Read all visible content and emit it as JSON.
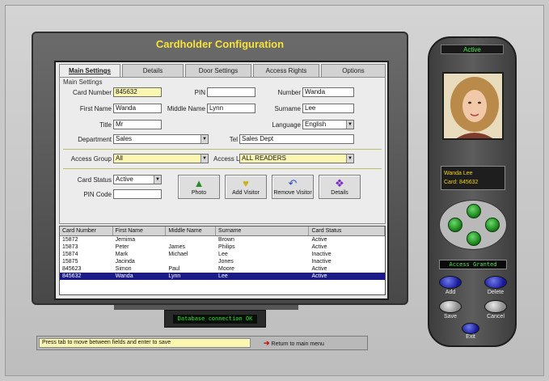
{
  "window": {
    "title": "Cardholder Configuration"
  },
  "tabs": [
    {
      "label": "Main Settings",
      "active": true
    },
    {
      "label": "Details"
    },
    {
      "label": "Door Settings"
    },
    {
      "label": "Access Rights"
    },
    {
      "label": "Options"
    }
  ],
  "form": {
    "group_label": "Main Settings",
    "fields": {
      "card_number": {
        "label": "Card Number",
        "value": "845632"
      },
      "pin": {
        "label": "PIN",
        "value": ""
      },
      "user_number": {
        "label": "Number",
        "value": "Wanda"
      },
      "first_name": {
        "label": "First Name",
        "value": "Wanda"
      },
      "middle_name": {
        "label": "Middle Name",
        "value": "Lynn"
      },
      "last_name": {
        "label": "Surname",
        "value": "Lee"
      },
      "title": {
        "label": "Title",
        "value": "Mr"
      },
      "language": {
        "label": "Language",
        "value": "English"
      },
      "department": {
        "label": "Department",
        "value": "Sales"
      },
      "phone": {
        "label": "Tel",
        "value": "Sales Dept"
      },
      "access_group": {
        "label": "Access Group",
        "value": "All"
      },
      "access_level": {
        "label": "Access Level",
        "value": "ALL READERS"
      },
      "card_status": {
        "label": "Card Status",
        "value": "Active"
      },
      "pin_code": {
        "label": "PIN Code",
        "value": ""
      }
    },
    "buttons": {
      "photo": "Photo",
      "add": "Add Visitor",
      "remove": "Remove Visitor",
      "details": "Details"
    }
  },
  "grid": {
    "columns": [
      "Card Number",
      "First Name",
      "Middle Name",
      "Surname",
      "Card Status"
    ],
    "rows": [
      [
        "15872",
        "Jemima",
        "",
        "Brown",
        "Active"
      ],
      [
        "15873",
        "Peter",
        "James",
        "Philips",
        "Active"
      ],
      [
        "15874",
        "Mark",
        "Michael",
        "Lee",
        "Inactive"
      ],
      [
        "15875",
        "Jacinda",
        "",
        "Jones",
        "Inactive"
      ],
      [
        "845623",
        "Simon",
        "Paul",
        "Moore",
        "Active"
      ],
      [
        "845632",
        "Wanda",
        "Lynn",
        "Lee",
        "Active"
      ]
    ],
    "selected_index": 5
  },
  "stand_display": "Database connection OK",
  "status": {
    "message": "Press tab to move between fields and enter to save",
    "link": "Return to main menu"
  },
  "device": {
    "status": "Active",
    "info": [
      "Wanda Lee",
      "Card: 845632"
    ],
    "led": "Access Granted",
    "buttons": [
      "Add",
      "Delete",
      "Save",
      "Cancel",
      "Exit"
    ]
  },
  "colors": {
    "title": "#f7e23a",
    "highlight_field": "#fbf6b0",
    "selected_row": "#1b1a88",
    "led_green": "#34e034",
    "blue_button": "#16199a"
  }
}
